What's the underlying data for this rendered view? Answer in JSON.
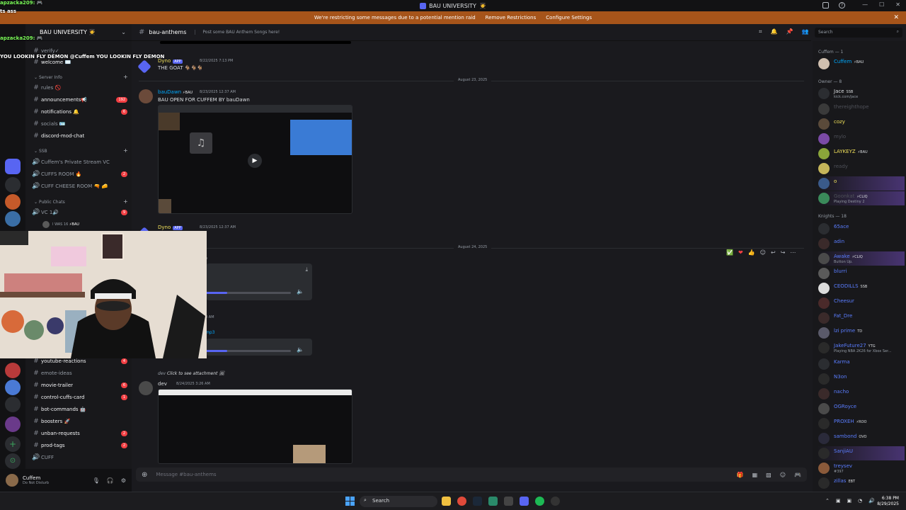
{
  "window": {
    "title": "BAU UNIVERSITY",
    "title_emoji": "🧑‍🎓",
    "banner_text": "We're restricting some messages due to a potential mention raid",
    "banner_remove": "Remove Restrictions",
    "banner_configure": "Configure Settings"
  },
  "server": {
    "name": "BAU UNIVERSITY",
    "name_emoji": "🧑‍🎓"
  },
  "channels": [
    {
      "label": "verify✓",
      "badge": "",
      "bright": false
    },
    {
      "label": "welcome ✉️",
      "badge": "",
      "bright": true
    },
    {
      "label": "rules 🚫",
      "badge": "",
      "bright": false
    },
    {
      "label": "announcements📢",
      "badge": "192",
      "bright": true
    },
    {
      "label": "notifications 🔔",
      "badge": "6",
      "bright": true
    },
    {
      "label": "socials 🪪",
      "badge": "",
      "bright": false
    },
    {
      "label": "discord-mod-chat",
      "badge": "",
      "bright": true
    }
  ],
  "categories": {
    "server_info": "Server Info",
    "ssb": "SSB",
    "public_chats": "Public Chats"
  },
  "voice_channels": [
    {
      "label": "Cuffem's Private Stream VC",
      "badge": ""
    },
    {
      "label": "CUFFS ROOM 🔥",
      "badge": "2"
    },
    {
      "label": "CUFF CHEESE ROOM 🔫 🧀",
      "badge": ""
    },
    {
      "label": "VC 1🔊",
      "badge": "9"
    }
  ],
  "voice_user": {
    "name": "I WAS 16",
    "tag": "⚡BAU"
  },
  "lower_channels": [
    {
      "label": "youtube-reactions",
      "badge": "4",
      "bright": true
    },
    {
      "label": "emote-ideas",
      "badge": "",
      "bright": false
    },
    {
      "label": "movie-trailer",
      "badge": "6",
      "bright": true
    },
    {
      "label": "control-cuffs-card",
      "badge": "1",
      "bright": true
    },
    {
      "label": "bot-commands 🤖",
      "badge": "",
      "bright": true
    },
    {
      "label": "boosters 🚀",
      "badge": "",
      "bright": true
    },
    {
      "label": "unban-requests",
      "badge": "2",
      "bright": true
    },
    {
      "label": "prod-tags",
      "badge": "2",
      "bright": true
    },
    {
      "label": "CUFF",
      "badge": "",
      "bright": false
    }
  ],
  "user_panel": {
    "name": "Cuffem",
    "status": "Do Not Disturb"
  },
  "channel": {
    "name": "bau-anthems",
    "topic": "Post some BAU Anthem Songs here!"
  },
  "search_placeholder": "Search",
  "messages": {
    "m1_author": "Dyno",
    "m1_app": "APP",
    "m1_time": "8/22/2025 7:13 PM",
    "m1_text": "THE GOAT 🐐🐐🐐",
    "date1": "August 23, 2025",
    "m2_author": "bauDawn",
    "m2_tag": "⚡BAU",
    "m2_time": "8/23/2025 12:37 AM",
    "m2_text": "BAU OPEN FOR CUFFEM BY bauDawn",
    "m3_author": "Dyno",
    "m3_app": "APP",
    "m3_time": "8/23/2025 12:37 AM",
    "date2": "August 24, 2025",
    "m4_partial": "n",
    "m5_time_partial": "0 AM",
    "m5_file_partial": "mp3",
    "reply_text": "Click to see attachment",
    "reply_author": "dev",
    "m6_author": "dev",
    "m6_time": "8/24/2025 3:26 AM"
  },
  "composer_placeholder": "Message #bau-anthems",
  "members": {
    "cat_cuffem": "Cuffem — 1",
    "cat_owner": "Owner — 8",
    "cat_knights": "Knights — 18",
    "list": [
      {
        "name": "Cuffem",
        "tag": "⚡BAU",
        "sub": "",
        "color": "#00a8fc"
      },
      {
        "name": "Jace",
        "tag": "SSB",
        "sub": "kick.com/jace",
        "color": "#dbdee1"
      },
      {
        "name": "thereighthope",
        "tag": "",
        "sub": "",
        "color": "#4e5058"
      },
      {
        "name": "cozy",
        "tag": "",
        "sub": "",
        "color": "#f0e05a"
      },
      {
        "name": "mylo",
        "tag": "",
        "sub": "",
        "color": "#4e5058"
      },
      {
        "name": "LAYKEYZ",
        "tag": "⚡BAU",
        "sub": "",
        "color": "#f0e05a"
      },
      {
        "name": "ready",
        "tag": "",
        "sub": "",
        "color": "#4e5058"
      },
      {
        "name": "o",
        "tag": "",
        "sub": "",
        "color": "#f0e05a"
      },
      {
        "name": "Goonkat",
        "tag": "⚡CLIQ",
        "sub": "Playing Destiny 2",
        "color": "#4e5058"
      },
      {
        "name": "65ace",
        "tag": "",
        "sub": "",
        "color": "#5a7dff"
      },
      {
        "name": "adin",
        "tag": "",
        "sub": "",
        "color": "#5a7dff"
      },
      {
        "name": "Awake",
        "tag": "⚡CLIQ",
        "sub": "Button Up.",
        "color": "#5a7dff"
      },
      {
        "name": "blurri",
        "tag": "",
        "sub": "",
        "color": "#5a7dff"
      },
      {
        "name": "CEODILLS",
        "tag": "SSB",
        "sub": "",
        "color": "#5a7dff"
      },
      {
        "name": "Cheesur",
        "tag": "",
        "sub": "",
        "color": "#5a7dff"
      },
      {
        "name": "Fat_Dre",
        "tag": "",
        "sub": "",
        "color": "#5a7dff"
      },
      {
        "name": "lzi prime",
        "tag": "TD",
        "sub": "",
        "color": "#5a7dff"
      },
      {
        "name": "JakeFuture27",
        "tag": "YTG",
        "sub": "Playing NBA 2K26 for Xbox Ser...",
        "color": "#5a7dff"
      },
      {
        "name": "Karma",
        "tag": "",
        "sub": "",
        "color": "#5a7dff"
      },
      {
        "name": "N3on",
        "tag": "",
        "sub": "",
        "color": "#5a7dff"
      },
      {
        "name": "nacho",
        "tag": "",
        "sub": "",
        "color": "#5a7dff"
      },
      {
        "name": "OGRoyce",
        "tag": "",
        "sub": "",
        "color": "#5a7dff"
      },
      {
        "name": "PROXEH",
        "tag": "⚡ROO",
        "sub": "",
        "color": "#5a7dff"
      },
      {
        "name": "sambond",
        "tag": "OVO",
        "sub": "",
        "color": "#5a7dff"
      },
      {
        "name": "SanjiAU",
        "tag": "",
        "sub": "",
        "color": "#5a7dff"
      },
      {
        "name": "treysev",
        "tag": "",
        "sub": "#397",
        "color": "#5a7dff"
      },
      {
        "name": "zillas",
        "tag": "EBT",
        "sub": "",
        "color": "#5a7dff"
      }
    ]
  },
  "stream_chat": [
    "apzacka209: 🎮",
    "                 ts ass",
    "",
    "",
    "apzacka209: 🎮",
    "",
    "",
    "            YOU LOOKIN FLY DEMON @Cuffem YOU LOOKIN FLY DEMON"
  ],
  "taskbar": {
    "search": "Search",
    "time": "6:38 PM",
    "date": "8/29/2025"
  },
  "colors": {
    "banner": "#a6541a",
    "accent": "#5865f2",
    "mention": "#00a8fc"
  }
}
